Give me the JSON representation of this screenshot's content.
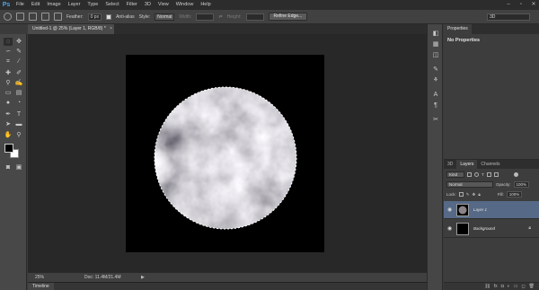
{
  "app": {
    "logo": "Ps"
  },
  "menu": [
    "File",
    "Edit",
    "Image",
    "Layer",
    "Type",
    "Select",
    "Filter",
    "3D",
    "View",
    "Window",
    "Help"
  ],
  "window_controls": {
    "minimize": "–",
    "restore": "▫",
    "close": "✕"
  },
  "options": {
    "feather_label": "Feather:",
    "feather_value": "0 px",
    "antialias_label": "Anti-alias",
    "style_label": "Style:",
    "style_value": "Normal",
    "width_label": "Width:",
    "height_label": "Height:",
    "refine_edge": "Refine Edge...",
    "workspace": "3D"
  },
  "document": {
    "tab_title": "Untitled-1 @ 25% (Layer 1, RGB/8) *",
    "tab_close": "×"
  },
  "status": {
    "zoom": "25%",
    "doc_info": "Doc: 11.4M/21.4M",
    "arrow": "▶"
  },
  "timeline": {
    "label": "Timeline"
  },
  "properties": {
    "tab": "Properties",
    "content": "No Properties"
  },
  "layers": {
    "tabs": [
      "3D",
      "Layers",
      "Channels"
    ],
    "kind": "Kind",
    "blend": "Normal",
    "opacity_label": "Opacity:",
    "opacity_value": "100%",
    "lock_label": "Lock:",
    "fill_label": "Fill:",
    "fill_value": "100%",
    "items": [
      {
        "name": "Layer 1",
        "selected": true
      },
      {
        "name": "Background",
        "selected": false
      }
    ]
  },
  "colors": {
    "accent": "#4aa3e4",
    "selected_layer": "#566986",
    "canvas": "#000000"
  }
}
